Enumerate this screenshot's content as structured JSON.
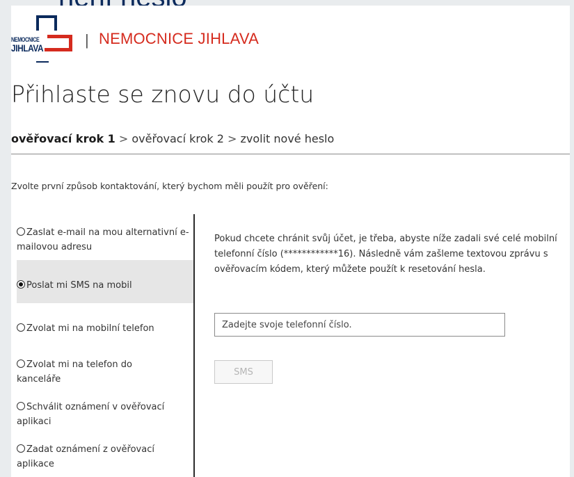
{
  "background_page": {
    "heading_fragment": "nění heslo"
  },
  "brand": {
    "logo_line1": "NEMOCNICE",
    "logo_line2": "JIHLAVA",
    "separator": "|",
    "name": "NEMOCNICE JIHLAVA",
    "accent_color": "#d52b1e",
    "navy_color": "#0b2a5c"
  },
  "page": {
    "title": "Přihlaste se znovu do účtu"
  },
  "breadcrumb": {
    "step1": "ověřovací krok 1",
    "sep1": " > ",
    "step2": "ověřovací krok 2",
    "sep2": " > ",
    "step3": "zvolit nové heslo"
  },
  "prompt": "Zvolte první způsob kontaktování, který bychom měli použít pro ověření:",
  "options": [
    {
      "label": "Zaslat e-mail na mou alternativní e-mailovou adresu",
      "selected": false
    },
    {
      "label": "Poslat mi SMS na mobil",
      "selected": true
    },
    {
      "label": "Zvolat mi na mobilní telefon",
      "selected": false
    },
    {
      "label": "Zvolat mi na telefon do kanceláře",
      "selected": false
    },
    {
      "label": "Schválit oznámení v ověřovací aplikaci",
      "selected": false
    },
    {
      "label": "Zadat oznámení z ověřovací aplikace",
      "selected": false
    }
  ],
  "sms_panel": {
    "info": "Pokud chcete chránit svůj účet, je třeba, abyste níže zadali své celé mobilní telefonní číslo (************16). Následně vám zašleme textovou zprávu s ověřovacím kódem, který můžete použít k resetování hesla.",
    "phone_placeholder": "Zadejte svoje telefonní číslo.",
    "phone_value": "",
    "sms_button": "SMS"
  }
}
